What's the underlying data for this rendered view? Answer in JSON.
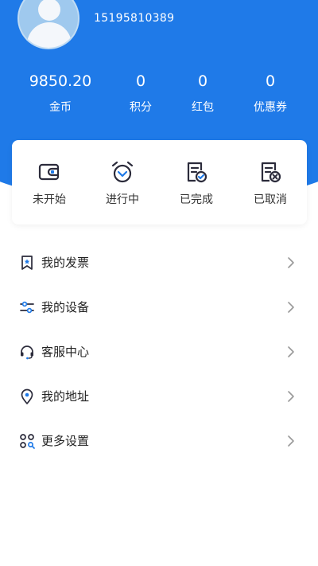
{
  "profile": {
    "phone": "15195810389"
  },
  "stats": [
    {
      "value": "9850.20",
      "label": "金币"
    },
    {
      "value": "0",
      "label": "积分"
    },
    {
      "value": "0",
      "label": "红包"
    },
    {
      "value": "0",
      "label": "优惠券"
    }
  ],
  "orders": [
    {
      "label": "未开始",
      "icon": "wallet-icon"
    },
    {
      "label": "进行中",
      "icon": "alarm-clock-icon"
    },
    {
      "label": "已完成",
      "icon": "document-check-icon"
    },
    {
      "label": "已取消",
      "icon": "document-cancel-icon"
    }
  ],
  "menu": [
    {
      "label": "我的发票",
      "icon": "invoice-bookmark-icon"
    },
    {
      "label": "我的设备",
      "icon": "sliders-icon"
    },
    {
      "label": "客服中心",
      "icon": "headset-icon"
    },
    {
      "label": "我的地址",
      "icon": "location-pin-icon"
    },
    {
      "label": "更多设置",
      "icon": "grid-settings-icon"
    }
  ],
  "colors": {
    "primary": "#1f7ae8",
    "text": "#222222",
    "icon": "#2b2b3b"
  }
}
